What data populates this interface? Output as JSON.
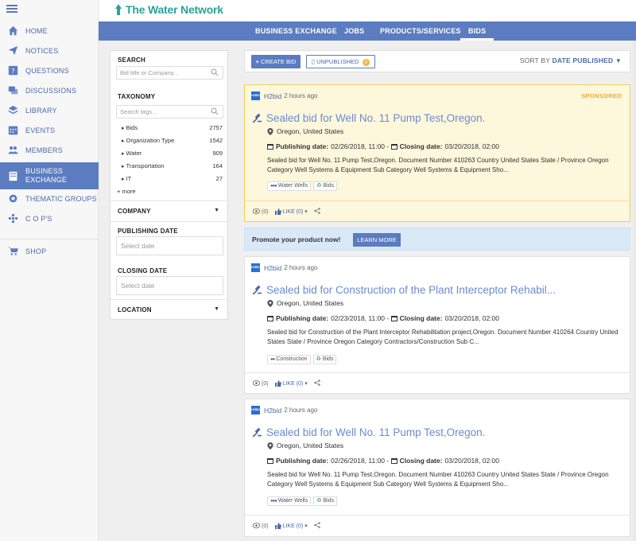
{
  "brand": {
    "name": "The Water Network",
    "color": "#2aa29a"
  },
  "colors": {
    "primary": "#5b7cc0",
    "sponsor_bg": "#fdf7dc",
    "sponsor_label": "#f0a830",
    "promo_bg": "#d9e9f7"
  },
  "nav": {
    "items": [
      {
        "label": "HOME",
        "icon": "home-icon"
      },
      {
        "label": "NOTICES",
        "icon": "paper-plane-icon"
      },
      {
        "label": "QUESTIONS",
        "icon": "question-icon"
      },
      {
        "label": "DISCUSSIONS",
        "icon": "chat-icon"
      },
      {
        "label": "LIBRARY",
        "icon": "layers-icon"
      },
      {
        "label": "EVENTS",
        "icon": "calendar-icon"
      },
      {
        "label": "MEMBERS",
        "icon": "users-icon"
      },
      {
        "label": "BUSINESS",
        "label2": "EXCHANGE",
        "icon": "building-icon",
        "active": true
      },
      {
        "label": "THEMATIC GROUPS",
        "icon": "gear-group-icon"
      },
      {
        "label": "C O P'S",
        "icon": "snowflake-icon"
      },
      {
        "label": "SHOP",
        "icon": "cart-icon"
      }
    ]
  },
  "tabs": [
    {
      "label": "BUSINESS EXCHANGE"
    },
    {
      "label": "JOBS"
    },
    {
      "label": "PRODUCTS/SERVICES"
    },
    {
      "label": "BIDS",
      "active": true
    }
  ],
  "filters": {
    "search_title": "SEARCH",
    "search_placeholder": "Bid title or Company...",
    "taxonomy_title": "TAXONOMY",
    "tags_placeholder": "Search tags...",
    "taxonomy": [
      {
        "name": "Bids",
        "count": "2757"
      },
      {
        "name": "Organization Type",
        "count": "1542"
      },
      {
        "name": "Water",
        "count": "909"
      },
      {
        "name": "Transportation",
        "count": "164"
      },
      {
        "name": "IT",
        "count": "27"
      }
    ],
    "more": "+ more",
    "company_title": "COMPANY",
    "publishing_title": "PUBLISHING DATE",
    "publishing_placeholder": "Select date",
    "closing_title": "CLOSING DATE",
    "closing_placeholder": "Select date",
    "location_title": "LOCATION"
  },
  "actions": {
    "create": "CREATE BID",
    "unpublished": "UNPUBLISHED",
    "unpublished_count": "0",
    "sort_prefix": "SORT BY",
    "sort_value": "DATE PUBLISHED"
  },
  "promo": {
    "text": "Promote your product now!",
    "button": "LEARN MORE"
  },
  "cards": [
    {
      "source": "H2bid",
      "source_logo": "H2BID",
      "time": "2 hours ago",
      "sponsored": "SPONSORED",
      "title": "Sealed bid for Well No. 11 Pump Test,Oregon.",
      "location": "Oregon, United States",
      "pub_label": "Publishing date:",
      "pub_date": "02/26/2018, 11:00 -",
      "close_label": "Closing date:",
      "close_date": "03/20/2018, 02:00",
      "desc": "Sealed bid for Well No. 11 Pump Test,Oregon. Document Number 410263 Country United States State / Province Oregon Category Well Systems & Equipment Sub Category Well Systems & Equipment Sho...",
      "tags": [
        {
          "label": "Water Wells",
          "kind": "dots3"
        },
        {
          "label": "Bids",
          "kind": "recycle"
        }
      ],
      "views": "(0)",
      "like": "LIKE (0)"
    },
    {
      "source": "H2bid",
      "source_logo": "H2BID",
      "time": "2 hours ago",
      "title": "Sealed bid for Construction of the Plant Interceptor Rehabil...",
      "location": "Oregon, United States",
      "pub_label": "Publishing date:",
      "pub_date": "02/23/2018, 11:00 -",
      "close_label": "Closing date:",
      "close_date": "03/20/2018, 02:00",
      "desc": "Sealed bid for Construction of the Plant Interceptor Rehabilitation project,Oregon. Document Number 410264 Country United States State / Province Oregon Category Contractors/Construction Sub C...",
      "tags": [
        {
          "label": "Construction",
          "kind": "dots2"
        },
        {
          "label": "Bids",
          "kind": "recycle"
        }
      ],
      "views": "(0)",
      "like": "LIKE (0)"
    },
    {
      "source": "H2bid",
      "source_logo": "H2BID",
      "time": "2 hours ago",
      "title": "Sealed bid for Well No. 11 Pump Test,Oregon.",
      "location": "Oregon, United States",
      "pub_label": "Publishing date:",
      "pub_date": "02/26/2018, 11:00 -",
      "close_label": "Closing date:",
      "close_date": "03/20/2018, 02:00",
      "desc": "Sealed bid for Well No. 11 Pump Test,Oregon. Document Number 410263 Country United States State / Province Oregon Category Well Systems & Equipment Sub Category Well Systems & Equipment Sho...",
      "tags": [
        {
          "label": "Water Wells",
          "kind": "dots3"
        },
        {
          "label": "Bids",
          "kind": "recycle"
        }
      ],
      "views": "(0)",
      "like": "LIKE (0)"
    }
  ]
}
